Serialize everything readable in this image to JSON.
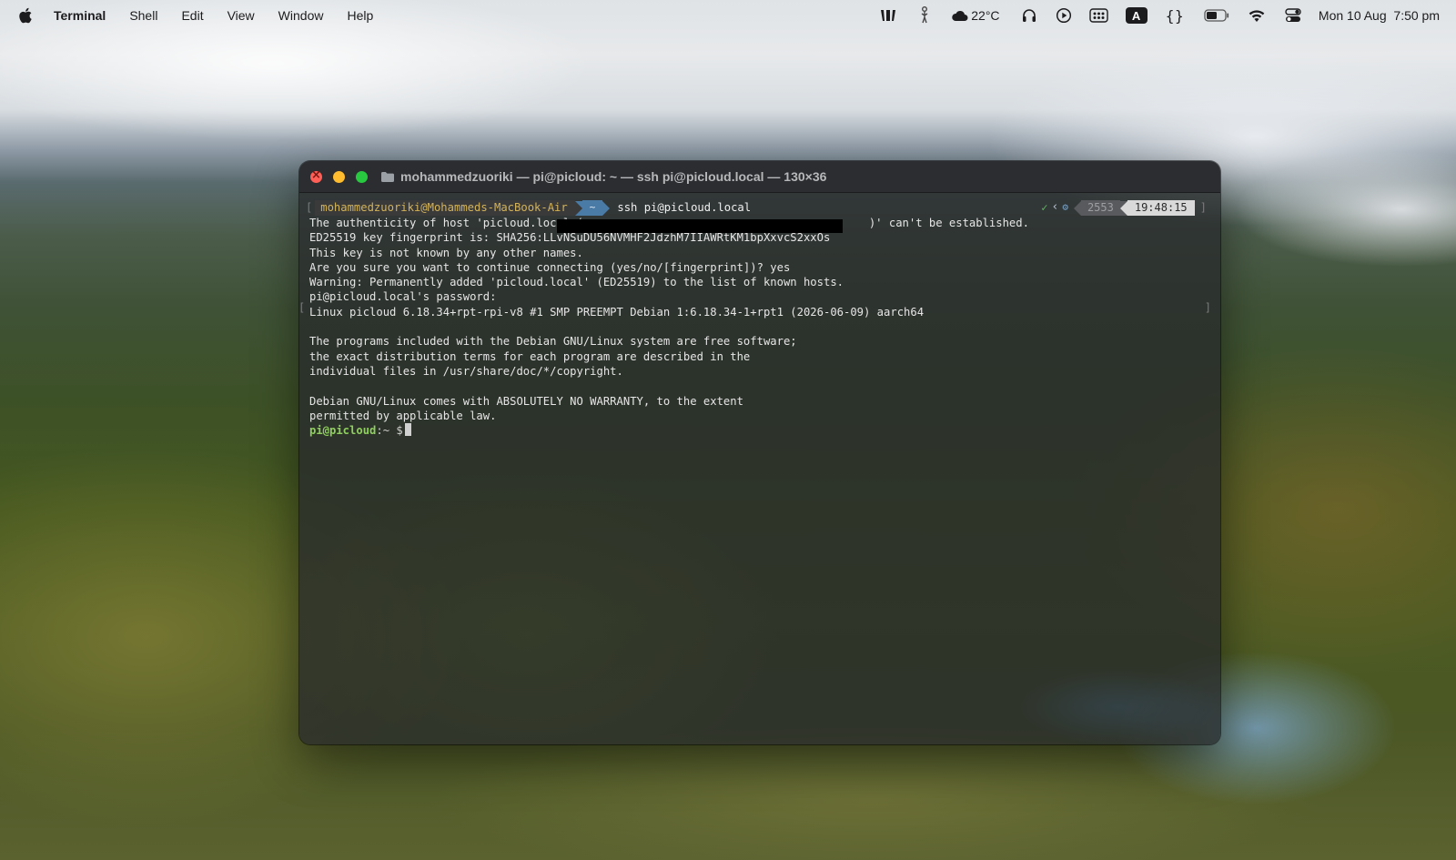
{
  "menubar": {
    "app_name": "Terminal",
    "menus": [
      "Shell",
      "Edit",
      "View",
      "Window",
      "Help"
    ],
    "weather": "22°C",
    "clock": "Mon 10 Aug  7:50 pm",
    "status_icons": [
      "mirror-icon",
      "figure-icon",
      "cloud-icon",
      "headphones-icon",
      "play-icon",
      "dots-grid-icon",
      "text-input-icon",
      "braces-icon",
      "battery-icon",
      "wifi-icon",
      "control-center-icon"
    ],
    "input_source_label": "A",
    "braces_label": "{}"
  },
  "window": {
    "title": "mohammedzuoriki — pi@picloud: ~ — ssh pi@picloud.local — 130×36"
  },
  "prompt": {
    "user_host": "mohammedzuoriki@Mohammeds-MacBook-Air",
    "dir": "~",
    "command": "ssh pi@picloud.local",
    "check": "✓",
    "history_number": "2553",
    "time": "19:48:15"
  },
  "output_lines": [
    "The authenticity of host 'picloud.local (",
    "ED25519 key fingerprint is: SHA256:LLvNSuDU56NVMHF2JdzhM7IIAWRtKM1bpXxvcS2xxOs",
    "This key is not known by any other names.",
    "Are you sure you want to continue connecting (yes/no/[fingerprint])? yes",
    "Warning: Permanently added 'picloud.local' (ED25519) to the list of known hosts.",
    "pi@picloud.local's password:",
    "Linux picloud 6.18.34+rpt-rpi-v8 #1 SMP PREEMPT Debian 1:6.18.34-1+rpt1 (2026-06-09) aarch64",
    "",
    "The programs included with the Debian GNU/Linux system are free software;",
    "the exact distribution terms for each program are described in the",
    "individual files in /usr/share/doc/*/copyright.",
    "",
    "Debian GNU/Linux comes with ABSOLUTELY NO WARRANTY, to the extent",
    "permitted by applicable law."
  ],
  "output_line1_tail": ")' can't be established.",
  "final_prompt": {
    "user": "pi@picloud",
    "path": ":~ $"
  },
  "colors": {
    "prompt_user": "#d3b35a",
    "prompt_dir_bg": "#4a7ba6",
    "remote_prompt": "#8fcf5f",
    "window_bg": "#282a2c"
  }
}
